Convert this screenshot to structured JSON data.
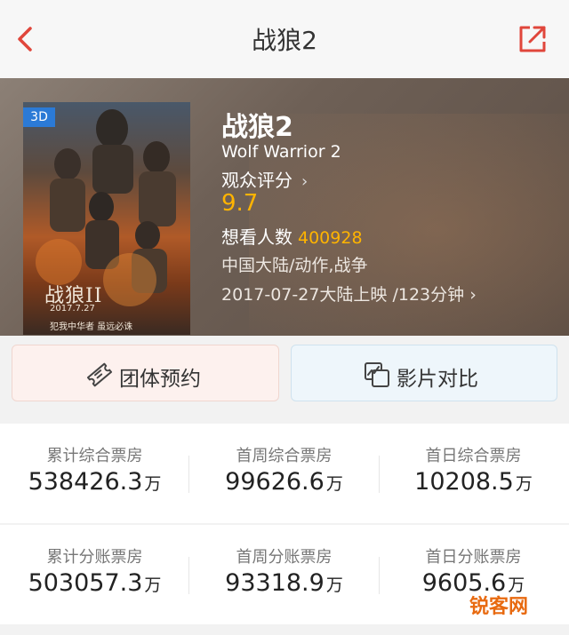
{
  "nav": {
    "title": "战狼2"
  },
  "movie": {
    "badge": "3D",
    "title_cn": "战狼2",
    "title_en": "Wolf Warrior 2",
    "rating_label": "观众评分",
    "rating_chevron": "›",
    "score": "9.7",
    "want_label": "想看人数",
    "want_count": "400928",
    "genre": "中国大陆/动作,战争",
    "release": "2017-07-27大陆上映 /123分钟",
    "release_chevron": "›",
    "poster": {
      "title": "战狼II",
      "date": "2017.7.27",
      "tagline": "犯我中华者 虽远必诛"
    }
  },
  "actions": {
    "group_label": "团体预约",
    "compare_label": "影片对比"
  },
  "stats": {
    "row1": [
      {
        "label": "累计综合票房",
        "value": "538426.3",
        "unit": "万"
      },
      {
        "label": "首周综合票房",
        "value": "99626.6",
        "unit": "万"
      },
      {
        "label": "首日综合票房",
        "value": "10208.5",
        "unit": "万"
      }
    ],
    "row2": [
      {
        "label": "累计分账票房",
        "value": "503057.3",
        "unit": "万"
      },
      {
        "label": "首周分账票房",
        "value": "93318.9",
        "unit": "万"
      },
      {
        "label": "首日分账票房",
        "value": "9605.6",
        "unit": "万"
      }
    ]
  },
  "watermark": "锐客网",
  "colors": {
    "accent_red": "#e0463b",
    "score_yellow": "#ffb400",
    "badge_blue": "#2b7ad6"
  }
}
